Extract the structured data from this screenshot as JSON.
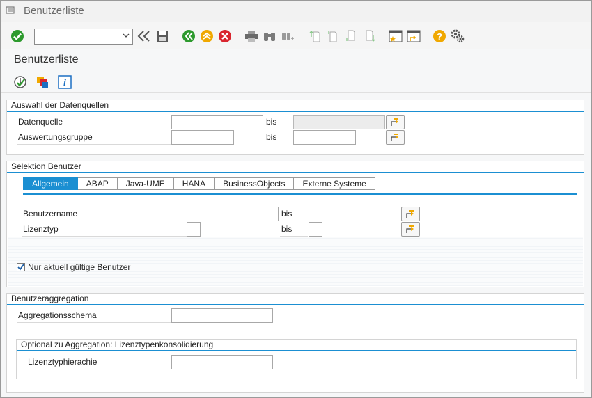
{
  "window": {
    "title": "Benutzerliste"
  },
  "toolbar": {
    "command_field_value": "",
    "icons": [
      "enter-icon",
      "chevron-down-icon",
      "back-double-icon",
      "save-icon",
      "back-icon",
      "exit-icon",
      "cancel-icon",
      "print-icon",
      "find-icon",
      "find-next-icon",
      "first-page-icon",
      "previous-page-icon",
      "next-page-icon",
      "last-page-icon",
      "create-session-icon",
      "shortcut-icon",
      "help-icon",
      "settings-icon"
    ]
  },
  "page": {
    "title": "Benutzerliste"
  },
  "app_toolbar": {
    "icons": [
      "execute-icon",
      "variants-icon",
      "info-icon"
    ]
  },
  "datenquellen": {
    "title": "Auswahl der Datenquellen",
    "rows": [
      {
        "label": "Datenquelle",
        "from_value": "",
        "bis": "bis",
        "to_value": ""
      },
      {
        "label": "Auswertungsgruppe",
        "from_value": "",
        "bis": "bis",
        "to_value": ""
      }
    ]
  },
  "selektion": {
    "title": "Selektion Benutzer",
    "tabs": [
      "Allgemein",
      "ABAP",
      "Java-UME",
      "HANA",
      "BusinessObjects",
      "Externe Systeme"
    ],
    "active_tab": "Allgemein",
    "rows": [
      {
        "label": "Benutzername",
        "from_value": "",
        "bis": "bis",
        "to_value": ""
      },
      {
        "label": "Lizenztyp",
        "from_value": "",
        "bis": "bis",
        "to_value": ""
      }
    ],
    "checkbox": {
      "label": "Nur aktuell gültige Benutzer",
      "checked": true
    }
  },
  "aggregation": {
    "title": "Benutzeraggregation",
    "label": "Aggregationsschema",
    "value": "",
    "sub": {
      "title": "Optional zu Aggregation: Lizenztypenkonsolidierung",
      "label": "Lizenztyphierachie",
      "value": ""
    }
  },
  "colors": {
    "accent": "#1b8fd2",
    "ok_green": "#2e9a2e",
    "cancel_red": "#d9262f",
    "warn_orange": "#f0a800"
  }
}
